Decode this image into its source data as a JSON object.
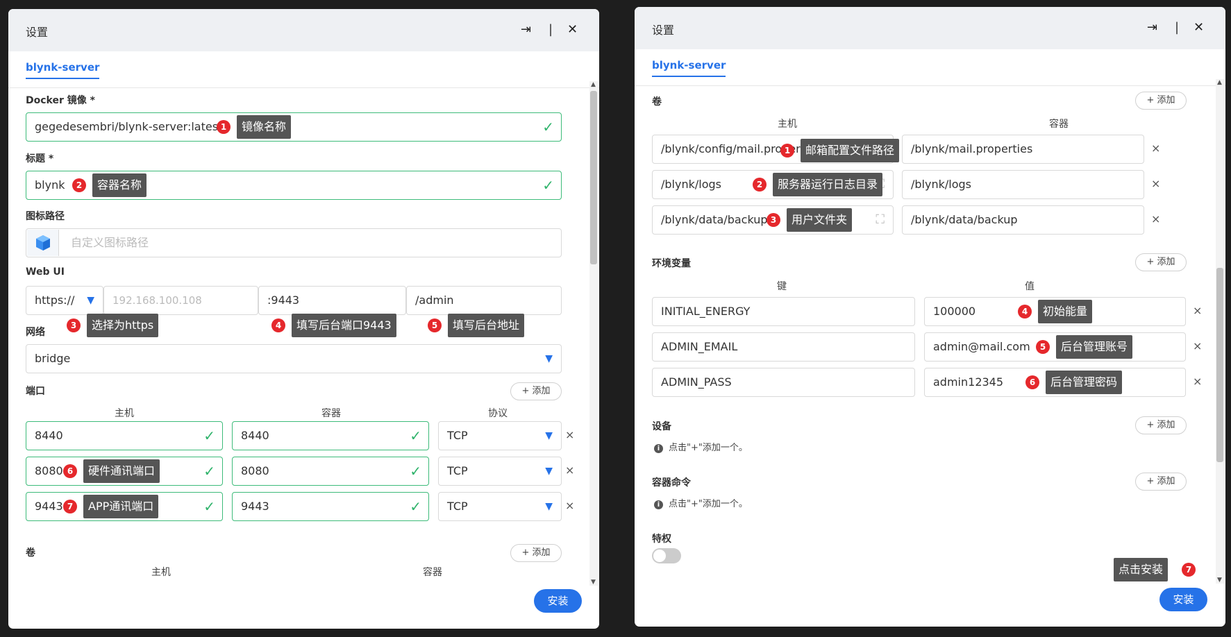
{
  "left": {
    "title": "设置",
    "tab": "blynk-server",
    "docker_label": "Docker 镜像 *",
    "docker_value": "gegedesembri/blynk-server:latest",
    "title_label": "标题 *",
    "title_value": "blynk",
    "icon_label": "图标路径",
    "icon_placeholder": "自定义图标路径",
    "webui_label": "Web UI",
    "webui_protocol": "https://",
    "webui_host_placeholder": "192.168.100.108",
    "webui_port": ":9443",
    "webui_path": "/admin",
    "network_label": "网络",
    "network_value": "bridge",
    "ports_label": "端口",
    "add_label": "+ 添加",
    "col_host": "主机",
    "col_container": "容器",
    "col_protocol": "协议",
    "ports": [
      {
        "host": "8440",
        "container": "8440",
        "protocol": "TCP"
      },
      {
        "host": "8080",
        "container": "8080",
        "protocol": "TCP"
      },
      {
        "host": "9443",
        "container": "9443",
        "protocol": "TCP"
      }
    ],
    "volumes_label": "卷",
    "vol_col_host": "主机",
    "vol_col_container": "容器",
    "install_label": "安装",
    "annotations": [
      {
        "n": "1",
        "text": "镜像名称"
      },
      {
        "n": "2",
        "text": "容器名称"
      },
      {
        "n": "3",
        "text": "选择为https"
      },
      {
        "n": "4",
        "text": "填写后台端口9443"
      },
      {
        "n": "5",
        "text": "填写后台地址"
      },
      {
        "n": "6",
        "text": "硬件通讯端口"
      },
      {
        "n": "7",
        "text": "APP通讯端口"
      }
    ]
  },
  "right": {
    "title": "设置",
    "tab": "blynk-server",
    "volumes_label": "卷",
    "add_label": "+ 添加",
    "vol_col_host": "主机",
    "vol_col_container": "容器",
    "volumes": [
      {
        "host": "/blynk/config/mail.properties",
        "container": "/blynk/mail.properties"
      },
      {
        "host": "/blynk/logs",
        "container": "/blynk/logs"
      },
      {
        "host": "/blynk/data/backup",
        "container": "/blynk/data/backup"
      }
    ],
    "env_label": "环境变量",
    "env_col_key": "键",
    "env_col_value": "值",
    "env": [
      {
        "key": "INITIAL_ENERGY",
        "value": "100000"
      },
      {
        "key": "ADMIN_EMAIL",
        "value": "admin@mail.com"
      },
      {
        "key": "ADMIN_PASS",
        "value": "admin12345"
      }
    ],
    "devices_label": "设备",
    "devices_hint": "点击\"+\"添加一个。",
    "cmd_label": "容器命令",
    "cmd_hint": "点击\"+\"添加一个。",
    "priv_label": "特权",
    "install_label": "安装",
    "annotations": [
      {
        "n": "1",
        "text": "邮箱配置文件路径"
      },
      {
        "n": "2",
        "text": "服务器运行日志目录"
      },
      {
        "n": "3",
        "text": "用户文件夹"
      },
      {
        "n": "4",
        "text": "初始能量"
      },
      {
        "n": "5",
        "text": "后台管理账号"
      },
      {
        "n": "6",
        "text": "后台管理密码"
      },
      {
        "n": "7",
        "text": "点击安装"
      }
    ]
  },
  "icons": [
    "exit-icon",
    "close-icon",
    "check-icon",
    "chevron-down-icon",
    "info-icon",
    "scan-icon",
    "cube-icon"
  ],
  "colors": {
    "accent": "#2672e8",
    "valid": "#3dbb7a",
    "badge": "#e5282c",
    "tooltip": "#555555"
  }
}
